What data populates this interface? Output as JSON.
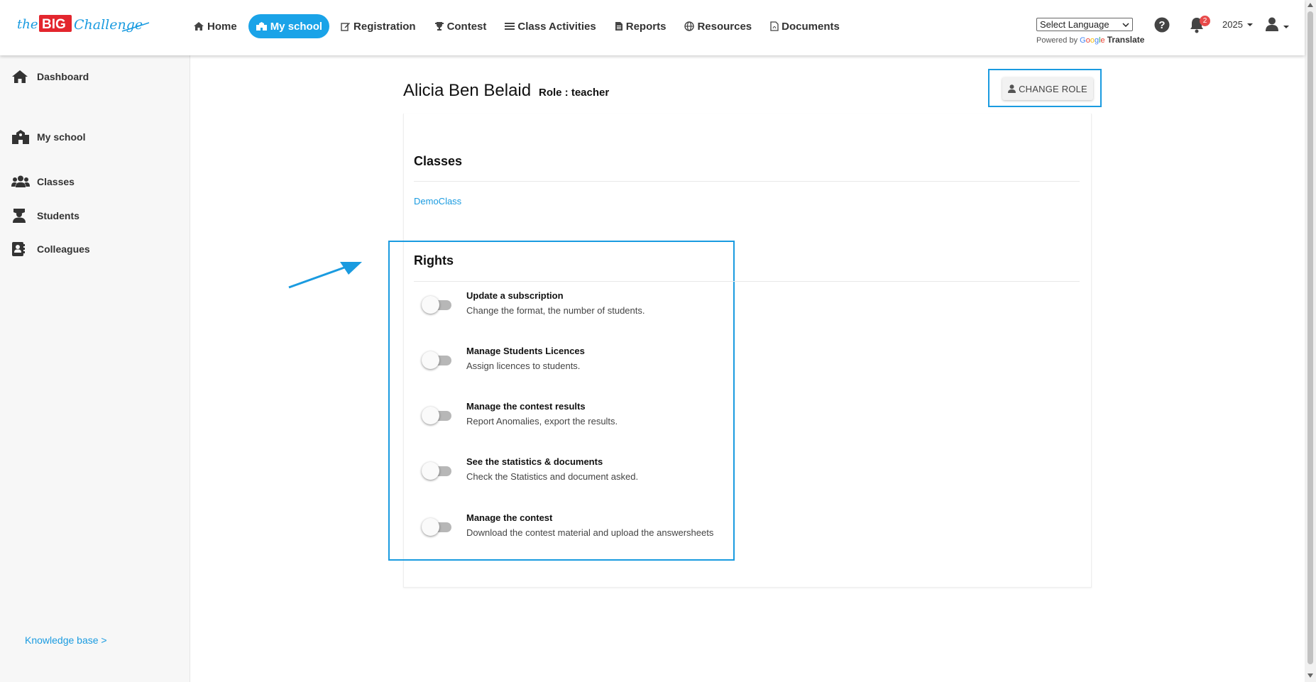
{
  "header": {
    "logo_parts": {
      "the": "the",
      "big": "BIG",
      "challenge": "Challenge"
    },
    "nav": [
      {
        "label": "Home",
        "icon": "home-icon"
      },
      {
        "label": "My school",
        "icon": "school-icon",
        "active": true
      },
      {
        "label": "Registration",
        "icon": "edit-icon"
      },
      {
        "label": "Contest",
        "icon": "trophy-icon"
      },
      {
        "label": "Class Activities",
        "icon": "list-icon"
      },
      {
        "label": "Reports",
        "icon": "file-icon"
      },
      {
        "label": "Resources",
        "icon": "globe-icon"
      },
      {
        "label": "Documents",
        "icon": "pdf-icon"
      }
    ],
    "language_select": {
      "value": "Select Language"
    },
    "powered_by": "Powered by",
    "google": "Google",
    "translate": "Translate",
    "notification_count": "2",
    "year": "2025"
  },
  "sidebar": {
    "items": [
      {
        "label": "Dashboard",
        "icon": "home-icon"
      },
      {
        "label": "My school",
        "icon": "school-icon"
      },
      {
        "label": "Classes",
        "icon": "users-icon"
      },
      {
        "label": "Students",
        "icon": "student-icon"
      },
      {
        "label": "Colleagues",
        "icon": "contact-book-icon"
      }
    ],
    "knowledge_base": "Knowledge base >"
  },
  "main": {
    "name": "Alicia Ben Belaid",
    "role": "Role : teacher",
    "change_role_label": "CHANGE ROLE",
    "classes_title": "Classes",
    "classes": [
      "DemoClass"
    ],
    "rights_title": "Rights",
    "rights": [
      {
        "title": "Update a subscription",
        "description": "Change the format, the number of students.",
        "enabled": false
      },
      {
        "title": "Manage Students Licences",
        "description": "Assign licences to students.",
        "enabled": false
      },
      {
        "title": "Manage the contest results",
        "description": "Report Anomalies, export the results.",
        "enabled": false
      },
      {
        "title": "See the statistics & documents",
        "description": "Check the Statistics and document asked.",
        "enabled": false
      },
      {
        "title": "Manage the contest",
        "description": "Download the contest material and upload the answersheets",
        "enabled": false
      }
    ]
  },
  "colors": {
    "accent": "#1aa3e8",
    "highlight_border": "#1a9be0",
    "logo_red": "#e3262e",
    "badge_red": "#e84a4a"
  }
}
